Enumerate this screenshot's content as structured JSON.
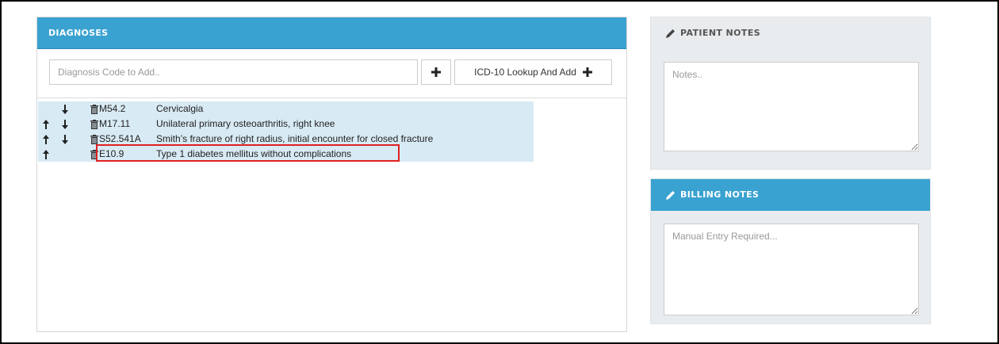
{
  "diagnoses": {
    "title": "DIAGNOSES",
    "input_placeholder": "Diagnosis Code to Add..",
    "lookup_label": "ICD-10 Lookup And Add",
    "rows": [
      {
        "code": "M54.2",
        "description": "Cervicalgia",
        "up": false,
        "down": true
      },
      {
        "code": "M17.11",
        "description": "Unilateral primary osteoarthritis, right knee",
        "up": true,
        "down": true
      },
      {
        "code": "S52.541A",
        "description": "Smith’s fracture of right radius, initial encounter for closed fracture",
        "up": true,
        "down": true
      },
      {
        "code": "E10.9",
        "description": "Type 1 diabetes mellitus without complications",
        "up": true,
        "down": false
      }
    ]
  },
  "patient_notes": {
    "title": "PATIENT NOTES",
    "placeholder": "Notes.."
  },
  "billing_notes": {
    "title": "BILLING NOTES",
    "placeholder": "Manual Entry Required..."
  },
  "colors": {
    "header_blue": "#3aa2d0",
    "row_highlight": "#d8eaf4",
    "annotation_red": "#e02020"
  }
}
